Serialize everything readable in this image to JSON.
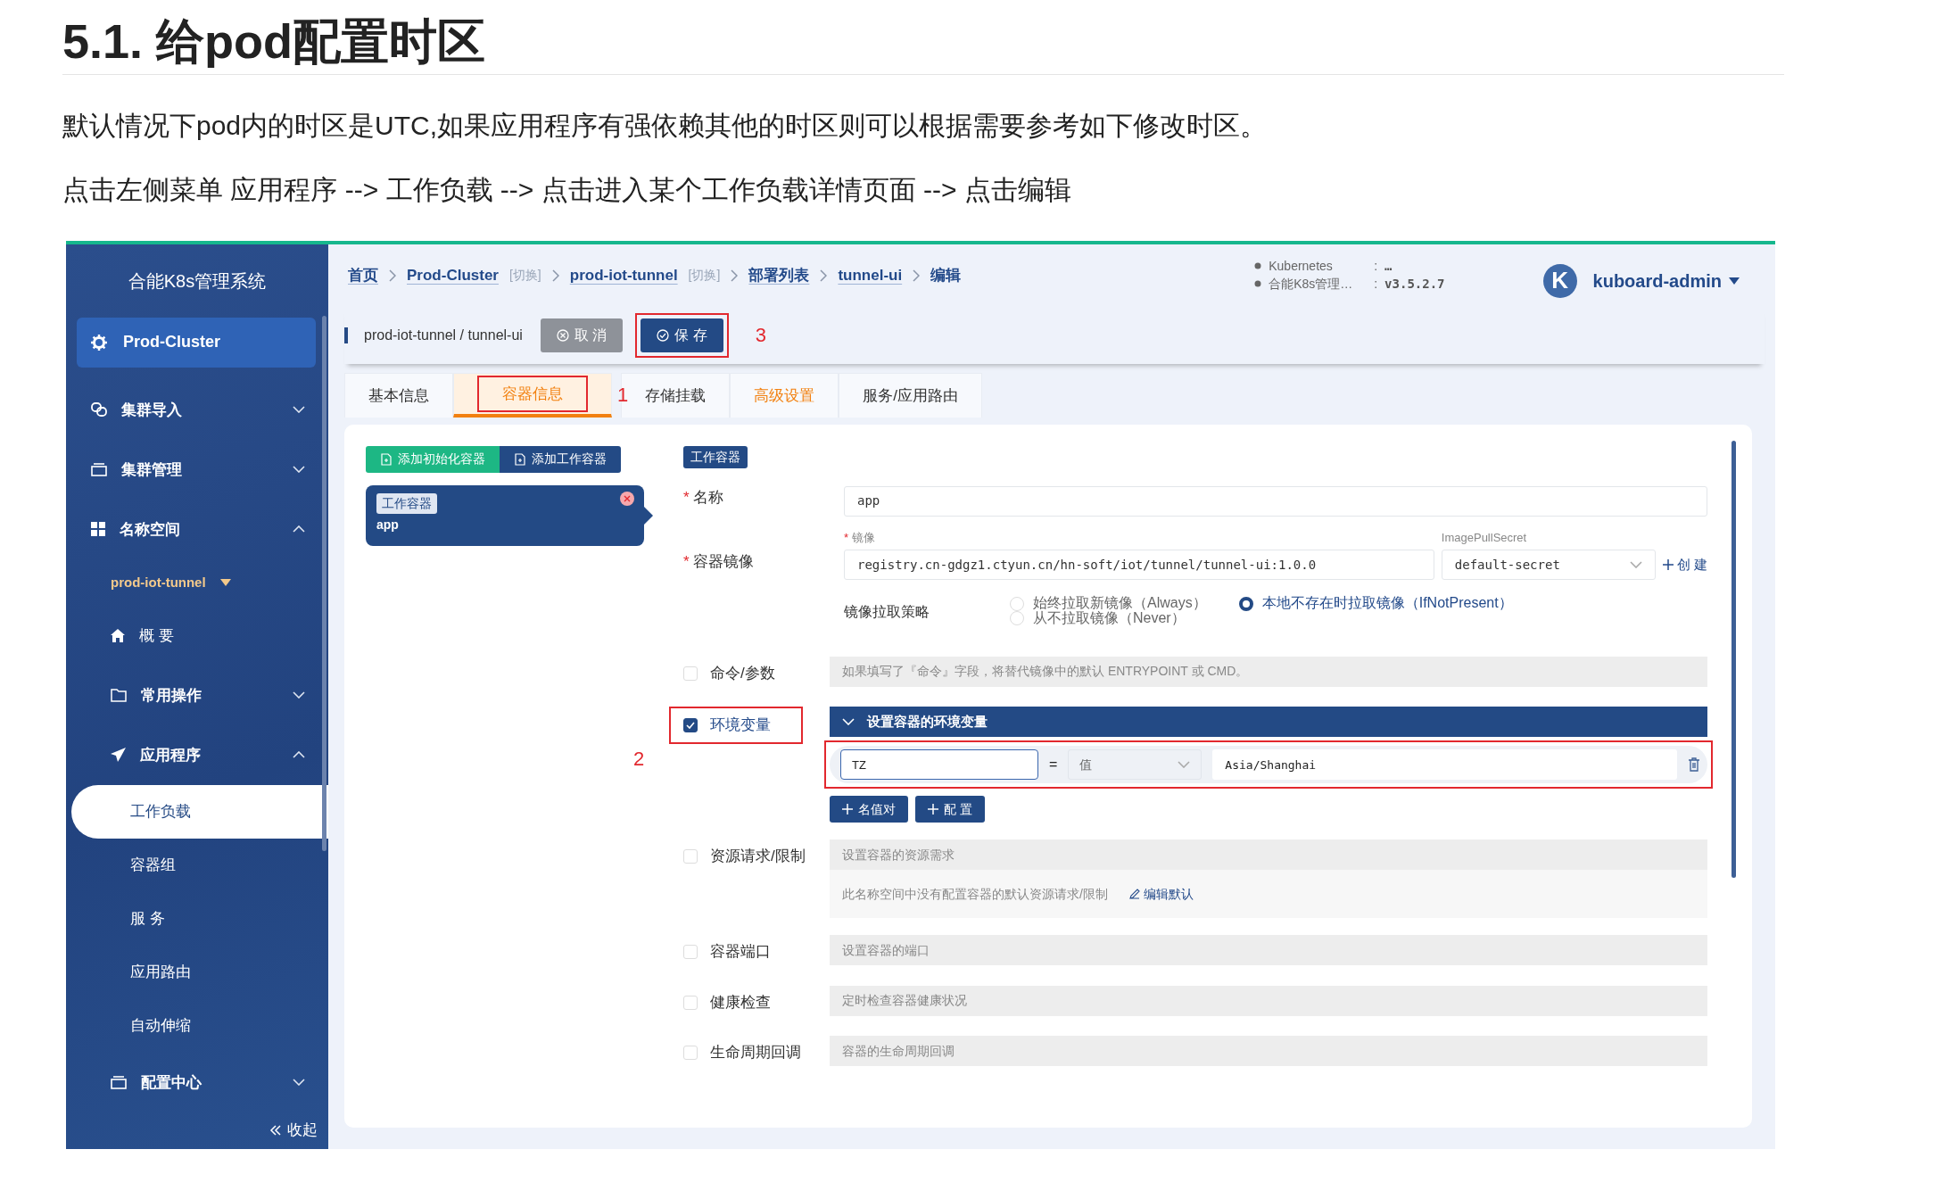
{
  "doc": {
    "heading": "5.1. 给pod配置时区",
    "paragraphs": [
      "默认情况下pod内的时区是UTC,如果应用程序有强依赖其他的时区则可以根据需要参考如下修改时区。",
      "点击左侧菜单 应用程序 --> 工作负载 --> 点击进入某个工作负载详情页面 --> 点击编辑"
    ]
  },
  "sidebar": {
    "title": "合能K8s管理系统",
    "cluster": "Prod-Cluster",
    "collapse": "收起",
    "items": [
      {
        "label": "集群导入",
        "kind": "group",
        "expanded": false
      },
      {
        "label": "集群管理",
        "kind": "group",
        "expanded": false
      },
      {
        "label": "名称空间",
        "kind": "group",
        "expanded": true
      },
      {
        "label": "prod-iot-tunnel",
        "kind": "namespace"
      },
      {
        "label": "概 要",
        "kind": "link"
      },
      {
        "label": "常用操作",
        "kind": "group",
        "expanded": false
      },
      {
        "label": "应用程序",
        "kind": "group",
        "expanded": true
      },
      {
        "label": "工作负载",
        "kind": "sub",
        "selected": true
      },
      {
        "label": "容器组",
        "kind": "sub",
        "selected": false
      },
      {
        "label": "服 务",
        "kind": "sub",
        "selected": false
      },
      {
        "label": "应用路由",
        "kind": "sub",
        "selected": false
      },
      {
        "label": "自动伸缩",
        "kind": "sub",
        "selected": false
      },
      {
        "label": "配置中心",
        "kind": "group",
        "expanded": false
      }
    ]
  },
  "breadcrumb": [
    {
      "label": "首页"
    },
    {
      "label": "Prod-Cluster",
      "switch": "[切换]"
    },
    {
      "label": "prod-iot-tunnel",
      "switch": "[切换]"
    },
    {
      "label": "部署列表"
    },
    {
      "label": "tunnel-ui"
    },
    {
      "label": "编辑",
      "current": true
    }
  ],
  "versions": [
    {
      "name": "Kubernetes",
      "sep": ":",
      "value": "…"
    },
    {
      "name": "合能K8s管理…",
      "sep": ":",
      "value": "v3.5.2.7"
    }
  ],
  "user": {
    "avatar": "K",
    "name": "kuboard-admin"
  },
  "toolbar": {
    "path": "prod-iot-tunnel / tunnel-ui",
    "buttons": [
      {
        "label": "取 消",
        "kind": "cancel"
      },
      {
        "label": "保 存",
        "kind": "save",
        "marker": "3"
      }
    ]
  },
  "tabs": [
    {
      "label": "基本信息",
      "selected": false,
      "warning": false
    },
    {
      "label": "容器信息",
      "selected": true,
      "warning": false,
      "marker": "1"
    },
    {
      "label": "存储挂载",
      "selected": false,
      "warning": false
    },
    {
      "label": "高级设置",
      "selected": false,
      "warning": true
    },
    {
      "label": "服务/应用路由",
      "selected": false,
      "warning": false
    }
  ],
  "containers": {
    "buttons": [
      {
        "label": "添加初始化容器",
        "kind": "init"
      },
      {
        "label": "添加工作容器",
        "kind": "work"
      }
    ],
    "items": [
      {
        "tag": "工作容器",
        "name": "app",
        "selected": true
      }
    ]
  },
  "form": {
    "tag": "工作容器",
    "name": {
      "required_mark": "*",
      "label": "名称",
      "value": "app"
    },
    "image": {
      "required_mark": "*",
      "label": "容器镜像",
      "sub_required_mark": "*",
      "sublabel": "镜像",
      "value": "registry.cn-gdgz1.ctyun.cn/hn-soft/iot/tunnel/tunnel-ui:1.0.0",
      "secret_label": "ImagePullSecret",
      "secret": "default-secret",
      "create": "创 建"
    },
    "pull_policy": {
      "label": "镜像拉取策略",
      "options": [
        {
          "label": "始终拉取新镜像（Always）",
          "selected": false
        },
        {
          "label": "从不拉取镜像（Never）",
          "selected": false
        },
        {
          "label": "本地不存在时拉取镜像（IfNotPresent）",
          "selected": true
        }
      ]
    },
    "sections": [
      {
        "label": "命令/参数",
        "checked": false,
        "outlined": false,
        "placeholder": "如果填写了『命令』字段，将替代镜像中的默认 ENTRYPOINT 或 CMD。"
      },
      {
        "label": "环境变量",
        "checked": true,
        "outlined": true,
        "panel_title": "设置容器的环境变量",
        "env": [
          {
            "name": "TZ",
            "operator": "=",
            "type": "值",
            "value": "Asia/Shanghai",
            "marker": "2"
          }
        ],
        "add_buttons": [
          "名值对",
          "配 置"
        ]
      },
      {
        "label": "资源请求/限制",
        "checked": false,
        "outlined": false,
        "placeholder": "设置容器的资源需求",
        "note": "此名称空间中没有配置容器的默认资源请求/限制",
        "note_link": "编辑默认"
      },
      {
        "label": "容器端口",
        "checked": false,
        "outlined": false,
        "placeholder": "设置容器的端口"
      },
      {
        "label": "健康检查",
        "checked": false,
        "outlined": false,
        "placeholder": "定时检查容器健康状况"
      },
      {
        "label": "生命周期回调",
        "checked": false,
        "outlined": false,
        "placeholder": "容器的生命周期回调"
      }
    ]
  }
}
